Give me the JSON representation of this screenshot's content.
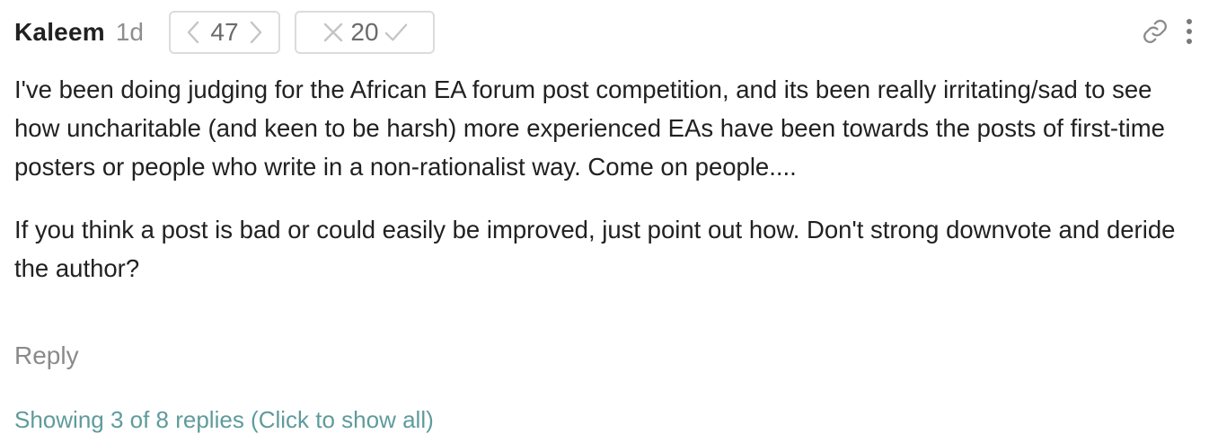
{
  "comment": {
    "author": "Kaleem",
    "age": "1d",
    "karma": {
      "score": "47",
      "downvote_icon": "chevron-left-icon",
      "upvote_icon": "chevron-right-icon"
    },
    "agreement": {
      "score": "20",
      "disagree_icon": "cross-icon",
      "agree_icon": "check-icon"
    },
    "actions": {
      "link_icon": "link-icon",
      "menu_icon": "vertical-dots-icon"
    },
    "paragraphs": [
      "I've been doing judging for the African EA forum post competition, and its been really irritating/sad to see how uncharitable (and keen to be harsh) more experienced EAs have been towards the posts of first-time posters or people who write in a non-rationalist way. Come on people....",
      "If you think a post is bad or could easily be improved, just point out how. Don't strong downvote and deride the author?"
    ],
    "reply_label": "Reply",
    "show_replies_label": "Showing 3 of 8 replies (Click to show all)"
  },
  "colors": {
    "text": "#212121",
    "muted": "#8e8e8e",
    "vote_border": "#dcdcdc",
    "vote_icon": "#c4c4c4",
    "link": "#5f9b9c"
  }
}
